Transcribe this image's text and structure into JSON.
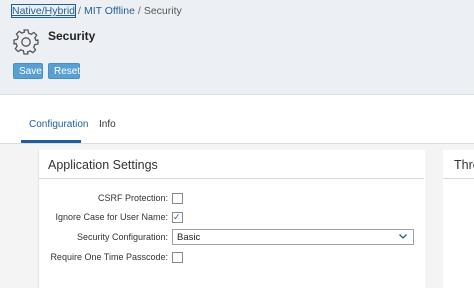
{
  "breadcrumb": {
    "item1": "Native/Hybrid",
    "sep1": "/",
    "item2": "MIT Offline",
    "sep2": "/",
    "current": "Security"
  },
  "header": {
    "title": "Security",
    "icon": "gear-icon"
  },
  "toolbar": {
    "save_label": "Save",
    "reset_label": "Reset",
    "button_color": "#5a9fd4"
  },
  "tabs": [
    {
      "label": "Configuration",
      "active": true
    },
    {
      "label": "Info",
      "active": false
    }
  ],
  "sections": {
    "application": {
      "title": "Application Settings",
      "fields": {
        "csrf": {
          "label": "CSRF Protection:",
          "checked": false
        },
        "ignore_case": {
          "label": "Ignore Case for User Name:",
          "checked": true
        },
        "security_config": {
          "label": "Security Configuration:",
          "value": "Basic"
        },
        "otp": {
          "label": "Require One Time Passcode:",
          "checked": false
        }
      }
    },
    "second_title": "Thre"
  },
  "colors": {
    "accent": "#1f5e99",
    "header_bg": "#ecf0f4"
  }
}
